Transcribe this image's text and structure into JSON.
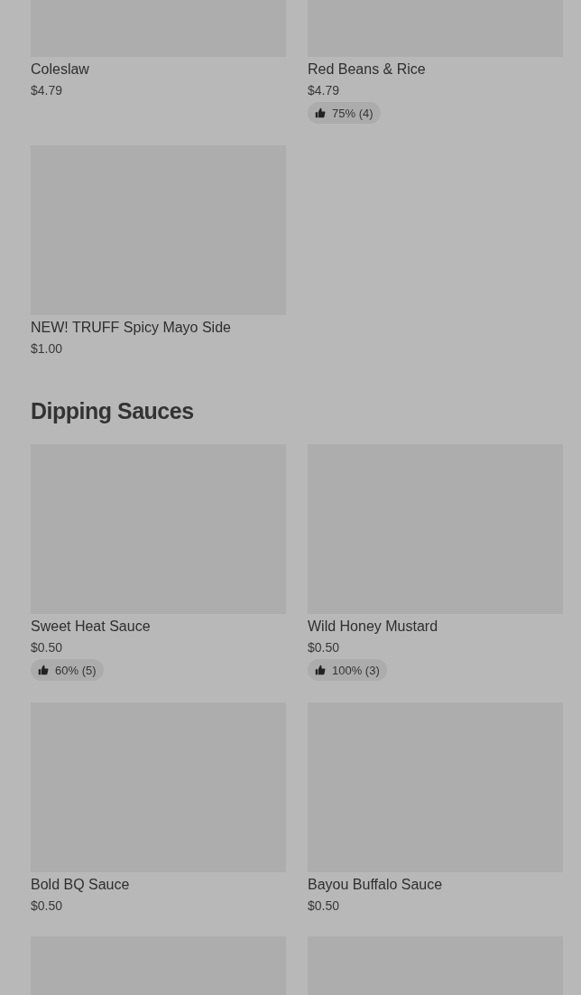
{
  "sections": [
    {
      "items": [
        {
          "kind": "dish",
          "name": "Coleslaw",
          "price": "$4.79"
        },
        {
          "kind": "dish",
          "name": "Red Beans & Rice",
          "price": "$4.79",
          "rating": "75% (4)"
        },
        {
          "kind": "dish",
          "name": "NEW! TRUFF Spicy Mayo Side",
          "price": "$1.00"
        }
      ]
    },
    {
      "title": "Dipping Sauces",
      "items": [
        {
          "kind": "dish",
          "name": "Sweet Heat Sauce",
          "price": "$0.50",
          "rating": "60% (5)"
        },
        {
          "kind": "dish",
          "name": "Wild Honey Mustard",
          "price": "$0.50",
          "rating": "100% (3)"
        },
        {
          "kind": "dish",
          "name": "Bold BQ Sauce",
          "price": "$0.50"
        },
        {
          "kind": "dish",
          "name": "Bayou Buffalo Sauce",
          "price": "$0.50"
        },
        {
          "kind": "image_only"
        },
        {
          "kind": "image_only"
        }
      ]
    }
  ]
}
